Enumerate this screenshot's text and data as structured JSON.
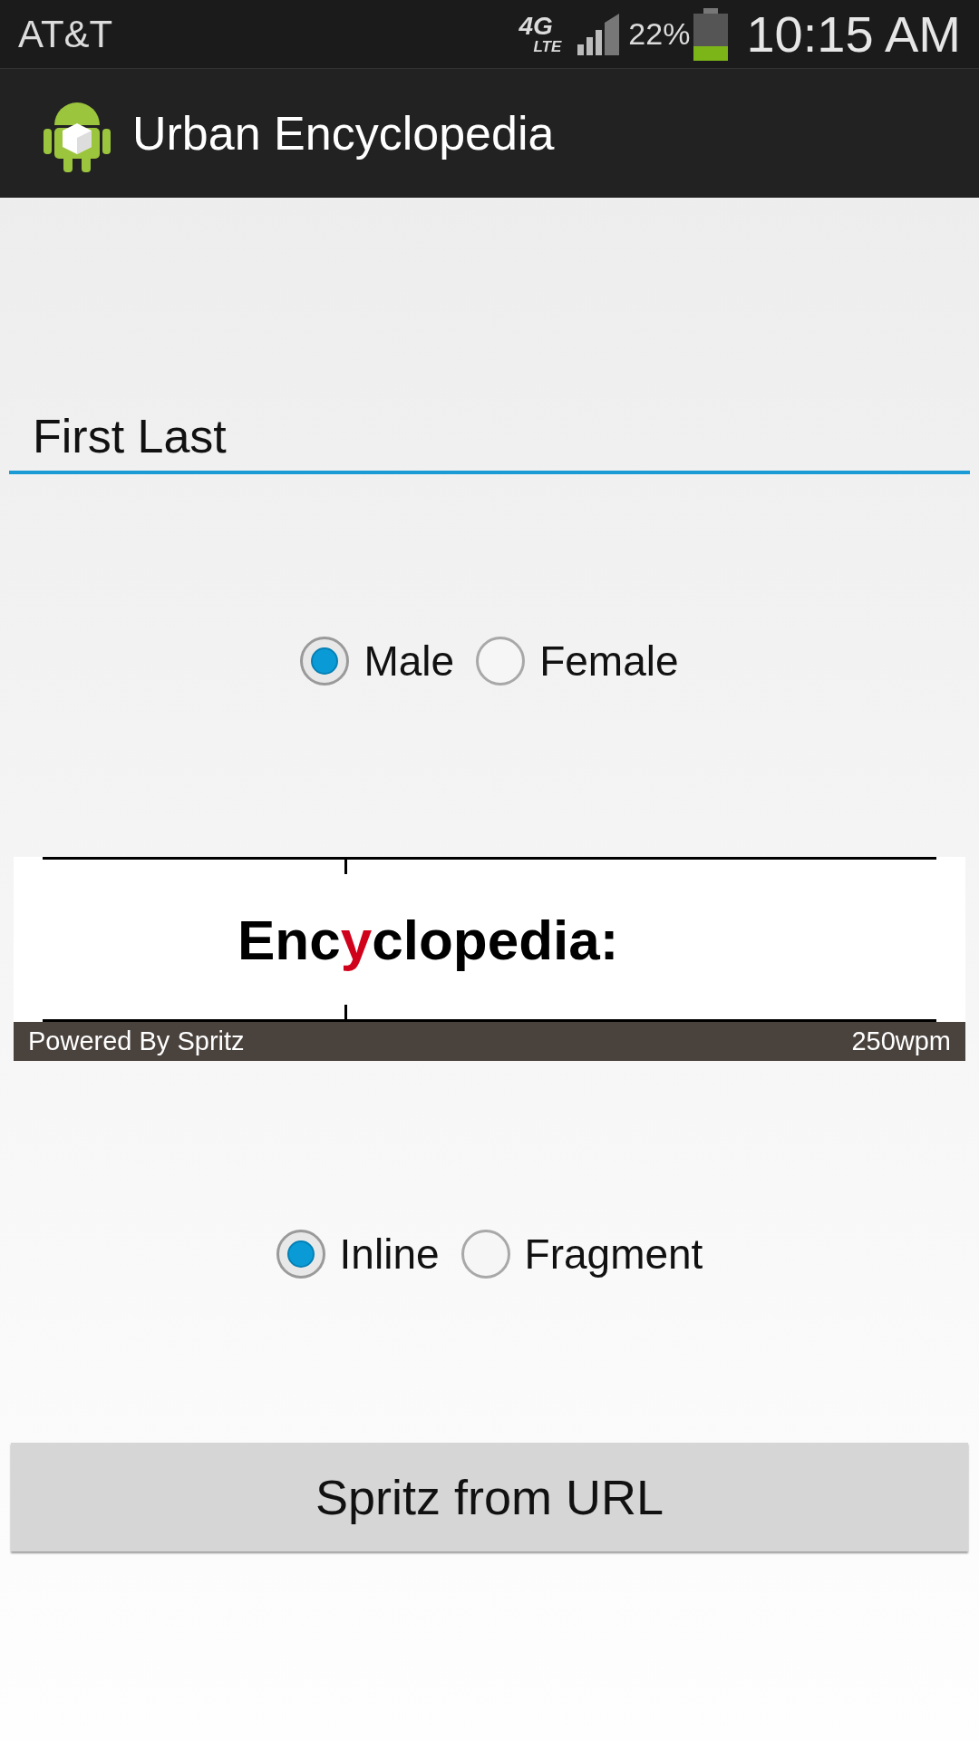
{
  "status_bar": {
    "carrier": "AT&T",
    "network": "4G",
    "network_sub": "LTE",
    "battery": "22%",
    "time": "10:15 AM"
  },
  "action_bar": {
    "title": "Urban Encyclopedia"
  },
  "name_field": {
    "value": "First Last"
  },
  "gender": [
    {
      "label": "Male",
      "selected": true
    },
    {
      "label": "Female",
      "selected": false
    }
  ],
  "spritz": {
    "word_before": "Enc",
    "word_pivot": "y",
    "word_after": "clopedia:",
    "footer_left": "Powered By Spritz",
    "footer_right": "250wpm"
  },
  "mode": [
    {
      "label": "Inline",
      "selected": true
    },
    {
      "label": "Fragment",
      "selected": false
    }
  ],
  "button": {
    "label": "Spritz from URL"
  }
}
